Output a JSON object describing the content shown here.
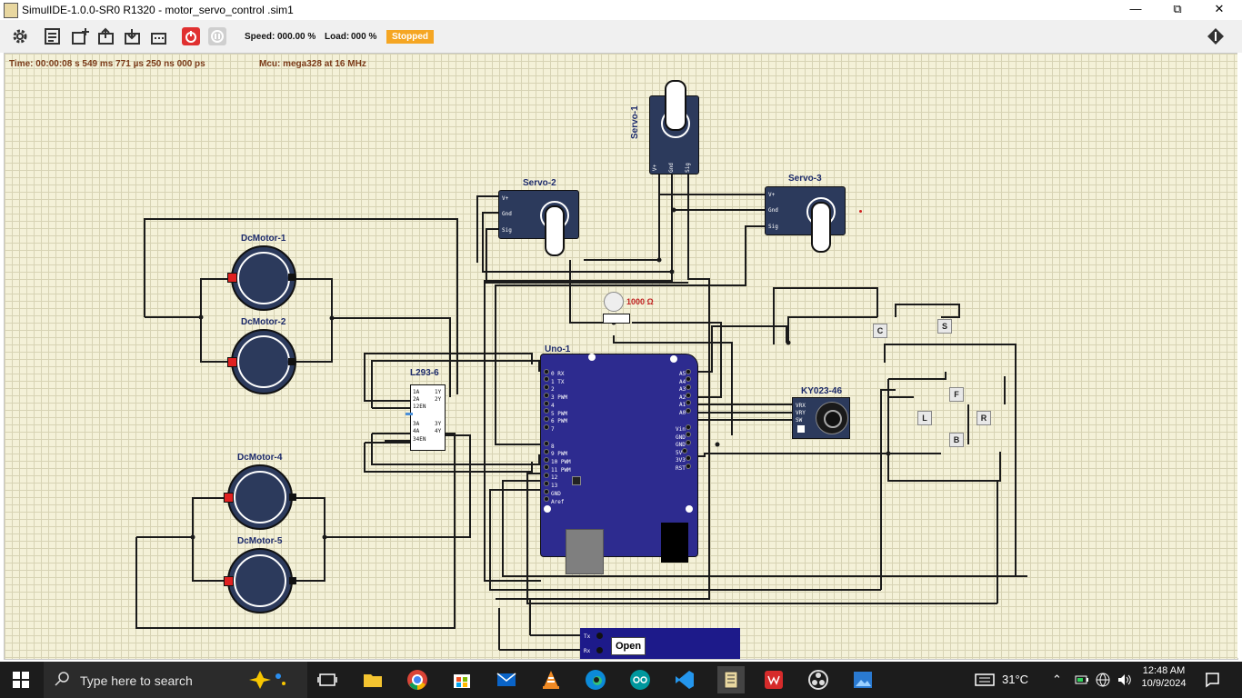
{
  "window": {
    "title": "SimulIDE-1.0.0-SR0 R1320 - motor_servo_control .sim1",
    "minimize": "—",
    "maximize": "⧉",
    "close": "✕"
  },
  "toolbar": {
    "speed_label": "Speed:",
    "speed_value": "000.00 %",
    "load_label": "Load:",
    "load_value": "000 %",
    "status": "Stopped"
  },
  "status": {
    "time": "Time: 00:00:08 s  549 ms  771 µs  250 ns  000 ps",
    "mcu": "Mcu: mega328 at 16 MHz"
  },
  "components": {
    "servo1": "Servo-1",
    "servo2": "Servo-2",
    "servo3": "Servo-3",
    "motor1": "DcMotor-1",
    "motor2": "DcMotor-2",
    "motor4": "DcMotor-4",
    "motor5": "DcMotor-5",
    "driver": "L293-6",
    "uno": "Uno-1",
    "joystick": "KY023-46",
    "pot_value": "1000 Ω"
  },
  "buttons": {
    "c": "C",
    "s": "S",
    "f": "F",
    "l": "L",
    "r": "R",
    "b": "B"
  },
  "serial": {
    "tx": "Tx",
    "rx": "Rx",
    "open": "Open"
  },
  "servo_pins": {
    "vp": "V+",
    "gnd": "Gnd",
    "sig": "Sig"
  },
  "l293_pins": {
    "p1a": "1A",
    "p2a": "2A",
    "p12en": "12EN",
    "p3a": "3A",
    "p4a": "4A",
    "p34en": "34EN",
    "p1y": "1Y",
    "p2y": "2Y",
    "p3y": "3Y",
    "p4y": "4Y"
  },
  "uno_digital": [
    "0 RX",
    "1 TX",
    "2",
    "3 PWM",
    "4",
    "5 PWM",
    "6 PWM",
    "7",
    "8",
    "9 PWM",
    "10 PWM",
    "11 PWM",
    "12",
    "13",
    "GND",
    "Aref"
  ],
  "uno_analog": [
    "A5",
    "A4",
    "A3",
    "A2",
    "A1",
    "A0"
  ],
  "uno_power": [
    "Vin",
    "GND",
    "GND",
    "5V",
    "3V3",
    "RST"
  ],
  "joystick_pins": {
    "vrx": "VRX",
    "vry": "VRY",
    "sw": "SW"
  },
  "taskbar": {
    "search_placeholder": "Type here to search",
    "weather": "31°C",
    "time": "12:48 AM",
    "date": "10/9/2024"
  },
  "colors": {
    "board": "#2d2b8f",
    "motor": "#2c3a5c",
    "stopped": "#f5a623",
    "wire": "#1a1a1a",
    "power_button": "#e03030"
  }
}
